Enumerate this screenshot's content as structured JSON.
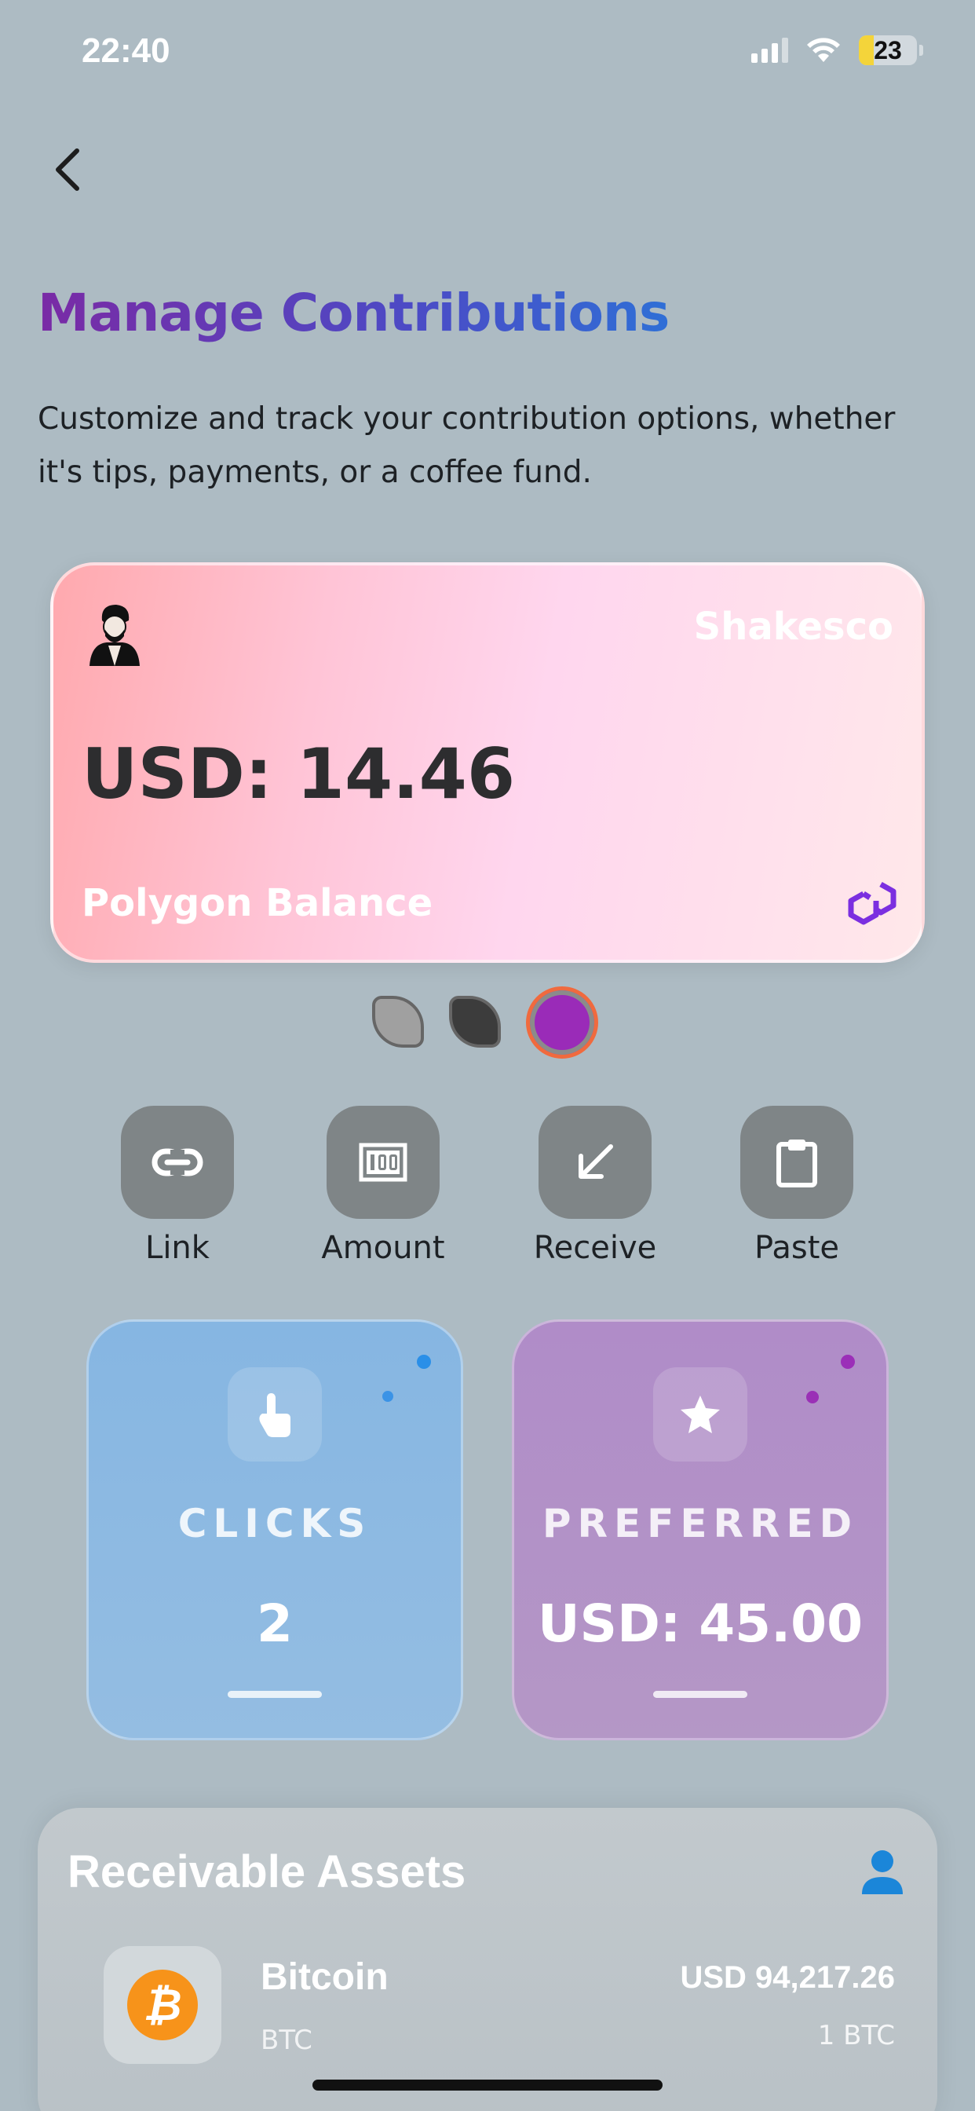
{
  "status_bar": {
    "time": "22:40",
    "battery": "23"
  },
  "header": {
    "title": "Manage Contributions",
    "description": "Customize and track your contribution options, whether it's tips, payments, or a coffee fund."
  },
  "balance_card": {
    "name": "Shakesco",
    "amount": "USD: 14.46",
    "label": "Polygon Balance"
  },
  "card_themes": [
    {
      "name": "grey-leaf",
      "color": "#a0a0a0"
    },
    {
      "name": "dark-leaf",
      "color": "#3c3c3c"
    },
    {
      "name": "purple-circle",
      "color": "#9a2bb8",
      "selected": true
    }
  ],
  "actions": [
    {
      "label": "Link",
      "icon": "link-icon"
    },
    {
      "label": "Amount",
      "icon": "amount-icon"
    },
    {
      "label": "Receive",
      "icon": "receive-icon"
    },
    {
      "label": "Paste",
      "icon": "paste-icon"
    }
  ],
  "stats": {
    "clicks": {
      "caption": "CLICKS",
      "value": "2",
      "icon": "tap-icon",
      "color": "#86b6e2"
    },
    "preferred": {
      "caption": "PREFERRED",
      "value": "USD: 45.00",
      "icon": "star-icon",
      "color": "#b08cc8"
    }
  },
  "assets": {
    "title": "Receivable Assets",
    "items": [
      {
        "name": "Bitcoin",
        "symbol": "BTC",
        "usd": "USD 94,217.26",
        "quantity": "1 BTC",
        "icon": "bitcoin-icon",
        "color": "#f7931a"
      }
    ]
  },
  "colors": {
    "background": "#adbbc3",
    "accent_blue": "#1b86d9",
    "selected_ring": "#f06a3e"
  }
}
